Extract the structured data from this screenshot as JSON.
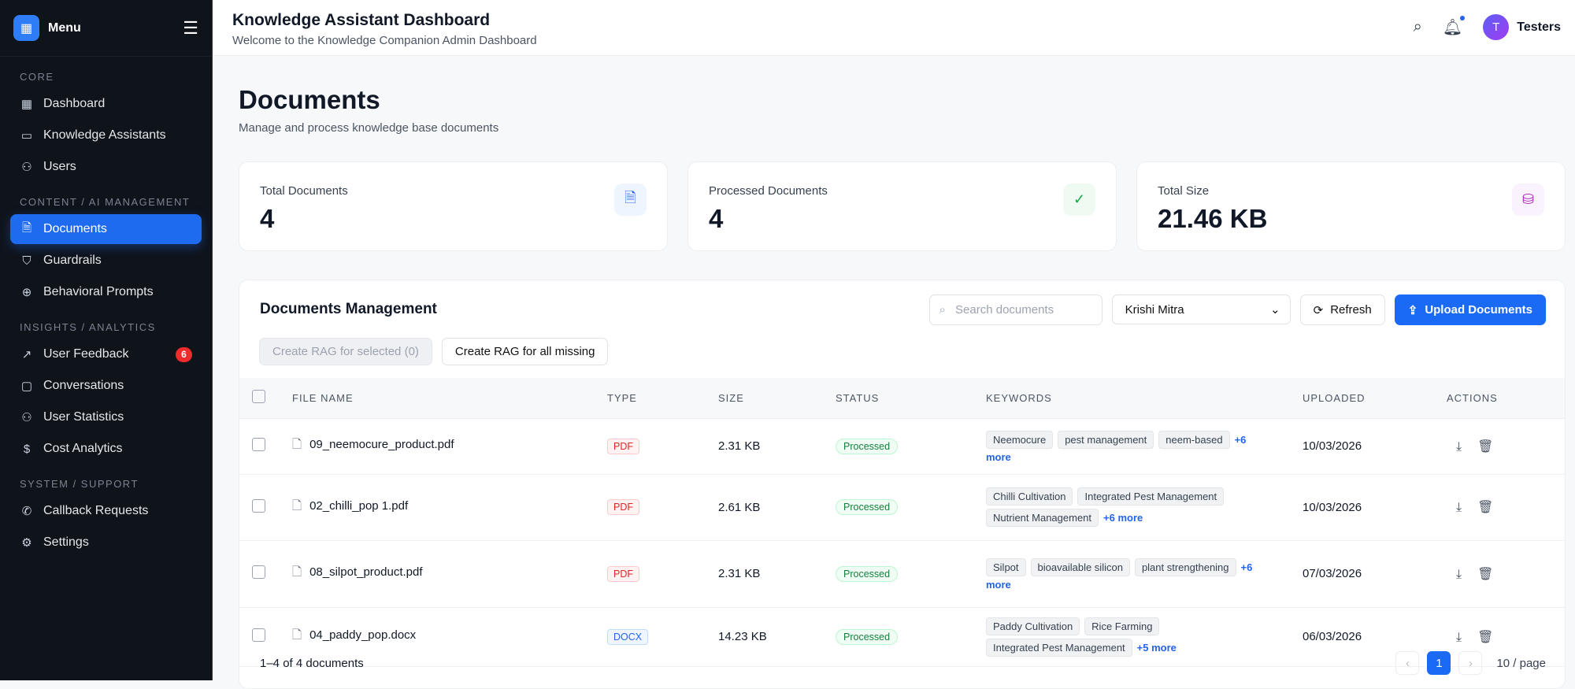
{
  "sidebar": {
    "title": "Menu",
    "sections": [
      {
        "label": "CORE",
        "items": [
          {
            "label": "Dashboard"
          },
          {
            "label": "Knowledge Assistants"
          },
          {
            "label": "Users"
          }
        ]
      },
      {
        "label": "CONTENT / AI MANAGEMENT",
        "items": [
          {
            "label": "Documents"
          },
          {
            "label": "Guardrails"
          },
          {
            "label": "Behavioral Prompts"
          }
        ]
      },
      {
        "label": "INSIGHTS / ANALYTICS",
        "items": [
          {
            "label": "User Feedback",
            "badge": "6"
          },
          {
            "label": "Conversations"
          },
          {
            "label": "User Statistics"
          },
          {
            "label": "Cost Analytics"
          }
        ]
      },
      {
        "label": "SYSTEM / SUPPORT",
        "items": [
          {
            "label": "Callback Requests"
          },
          {
            "label": "Settings"
          }
        ]
      }
    ]
  },
  "header": {
    "title": "Knowledge Assistant Dashboard",
    "subtitle": "Welcome to the Knowledge Companion Admin Dashboard",
    "avatar_initial": "T",
    "user": "Testers"
  },
  "page": {
    "title": "Documents",
    "subtitle": "Manage and process knowledge base documents"
  },
  "stats": [
    {
      "label": "Total Documents",
      "value": "4"
    },
    {
      "label": "Processed Documents",
      "value": "4"
    },
    {
      "label": "Total Size",
      "value": "21.46 KB"
    }
  ],
  "panel": {
    "title": "Documents Management",
    "search_placeholder": "Search documents",
    "assistant": "Krishi Mitra",
    "refresh": "Refresh",
    "upload": "Upload Documents",
    "rag_selected": "Create RAG for selected (0)",
    "rag_missing": "Create RAG for all missing"
  },
  "table": {
    "columns": [
      "FILE NAME",
      "TYPE",
      "SIZE",
      "STATUS",
      "KEYWORDS",
      "UPLOADED",
      "ACTIONS"
    ],
    "rows": [
      {
        "name": "09_neemocure_product.pdf",
        "type": "PDF",
        "size": "2.31 KB",
        "status": "Processed",
        "keywords": [
          "Neemocure",
          "pest management",
          "neem-based"
        ],
        "more": "+6 more",
        "uploaded": "10/03/2026"
      },
      {
        "name": "02_chilli_pop 1.pdf",
        "type": "PDF",
        "size": "2.61 KB",
        "status": "Processed",
        "keywords": [
          "Chilli Cultivation",
          "Integrated Pest Management",
          "Nutrient Management"
        ],
        "more": "+6 more",
        "uploaded": "10/03/2026"
      },
      {
        "name": "08_silpot_product.pdf",
        "type": "PDF",
        "size": "2.31 KB",
        "status": "Processed",
        "keywords": [
          "Silpot",
          "bioavailable silicon",
          "plant strengthening"
        ],
        "more": "+6 more",
        "uploaded": "07/03/2026"
      },
      {
        "name": "04_paddy_pop.docx",
        "type": "DOCX",
        "size": "14.23 KB",
        "status": "Processed",
        "keywords": [
          "Paddy Cultivation",
          "Rice Farming",
          "Integrated Pest Management"
        ],
        "more": "+5 more",
        "uploaded": "06/03/2026"
      }
    ]
  },
  "footer": {
    "range": "1–4 of 4 documents",
    "page": "1",
    "page_size": "10 / page"
  }
}
